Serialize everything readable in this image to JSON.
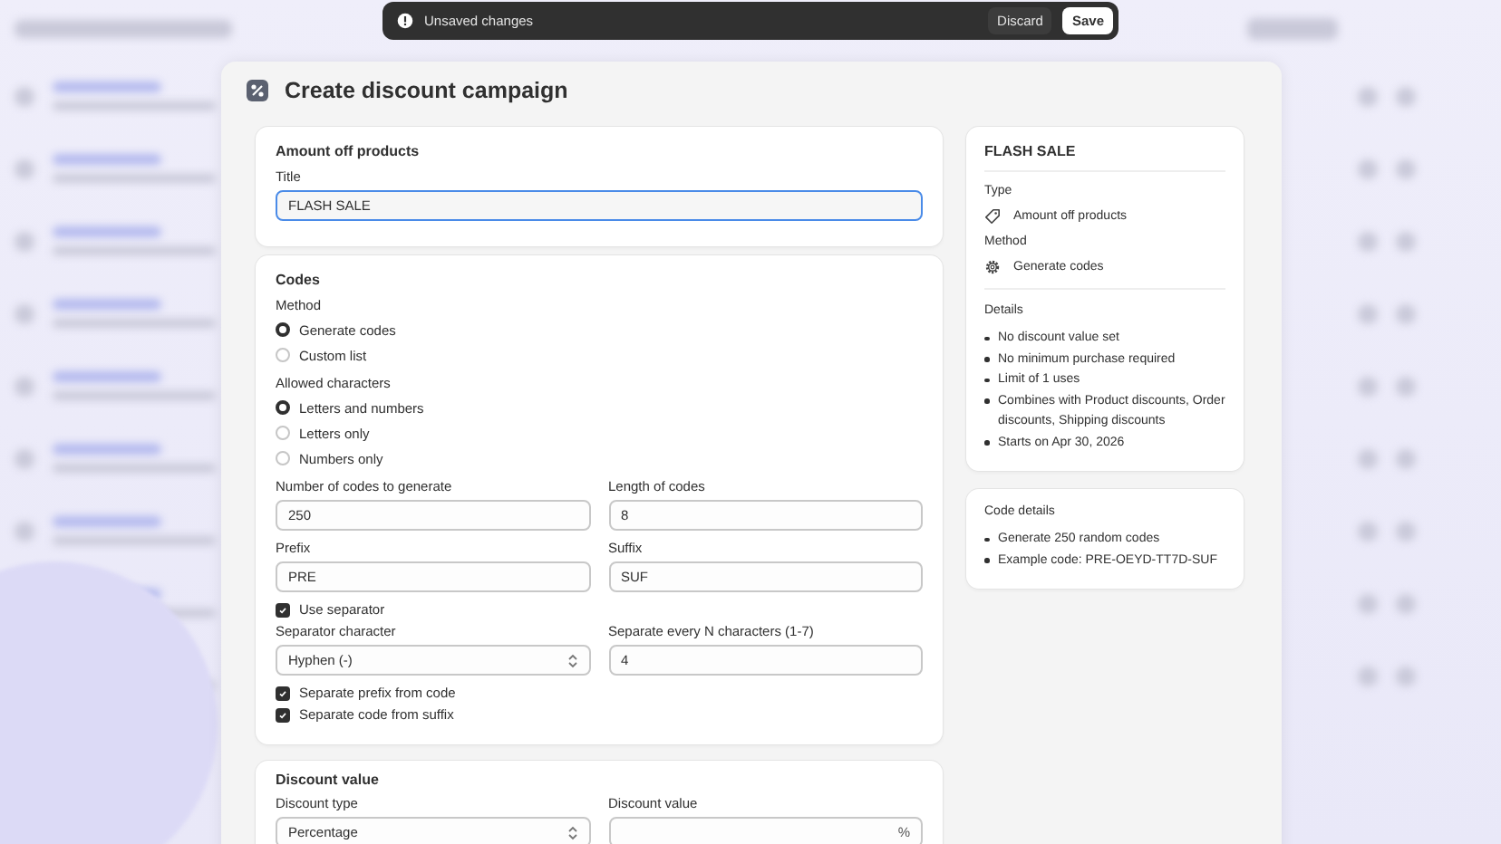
{
  "toast": {
    "message": "Unsaved changes",
    "buttons": [
      {
        "label": "Discard",
        "kind": "secondary"
      },
      {
        "label": "Save",
        "kind": "primary"
      }
    ]
  },
  "modal": {
    "title": "Create discount campaign"
  },
  "amount_card": {
    "heading": "Amount off products",
    "label": "Title",
    "value": "FLASH SALE",
    "focused": true
  },
  "codes_card": {
    "heading": "Codes",
    "radio_groups": [
      {
        "label": "Method",
        "options": [
          {
            "label": "Generate codes",
            "selected": true
          },
          {
            "label": "Custom list",
            "selected": false
          }
        ]
      },
      {
        "label": "Allowed characters",
        "options": [
          {
            "label": "Letters and numbers",
            "selected": true
          },
          {
            "label": "Letters only",
            "selected": false
          },
          {
            "label": "Numbers only",
            "selected": false
          }
        ]
      }
    ],
    "rows": [
      {
        "kind": "pair",
        "fields": [
          {
            "kind": "input",
            "label": "Number of codes to generate",
            "value": "250"
          },
          {
            "kind": "input",
            "label": "Length of codes",
            "value": "8"
          }
        ]
      },
      {
        "kind": "pair",
        "fields": [
          {
            "kind": "input",
            "label": "Prefix",
            "value": "PRE"
          },
          {
            "kind": "input",
            "label": "Suffix",
            "value": "SUF"
          }
        ]
      },
      {
        "kind": "checkbox",
        "label": "Use separator",
        "checked": true
      },
      {
        "kind": "pair",
        "fields": [
          {
            "kind": "select",
            "label": "Separator character",
            "value": "Hyphen (-)"
          },
          {
            "kind": "input",
            "label": "Separate every N characters (1-7)",
            "value": "4"
          }
        ]
      },
      {
        "kind": "checkbox",
        "label": "Separate prefix from code",
        "checked": true
      },
      {
        "kind": "checkbox",
        "label": "Separate code from suffix",
        "checked": true
      }
    ]
  },
  "discount_card": {
    "heading": "Discount value",
    "fields": [
      {
        "kind": "select",
        "label": "Discount type",
        "value": "Percentage"
      },
      {
        "kind": "input",
        "label": "Discount value",
        "suffix": "%"
      }
    ]
  },
  "summary": {
    "title": "FLASH SALE",
    "facts": [
      {
        "label": "Type",
        "value": "Amount off products"
      },
      {
        "label": "Method",
        "value": "Generate codes"
      }
    ],
    "details_label": "Details",
    "details": [
      "No discount value set",
      "No minimum purchase required",
      "Limit of 1 uses",
      "Combines with Product discounts, Order discounts, Shipping discounts",
      "Starts on Apr 30, 2026"
    ]
  },
  "code_details": {
    "heading": "Code details",
    "items": [
      "Generate 250 random codes",
      "Example code: PRE-OEYD-TT7D-SUF"
    ]
  }
}
